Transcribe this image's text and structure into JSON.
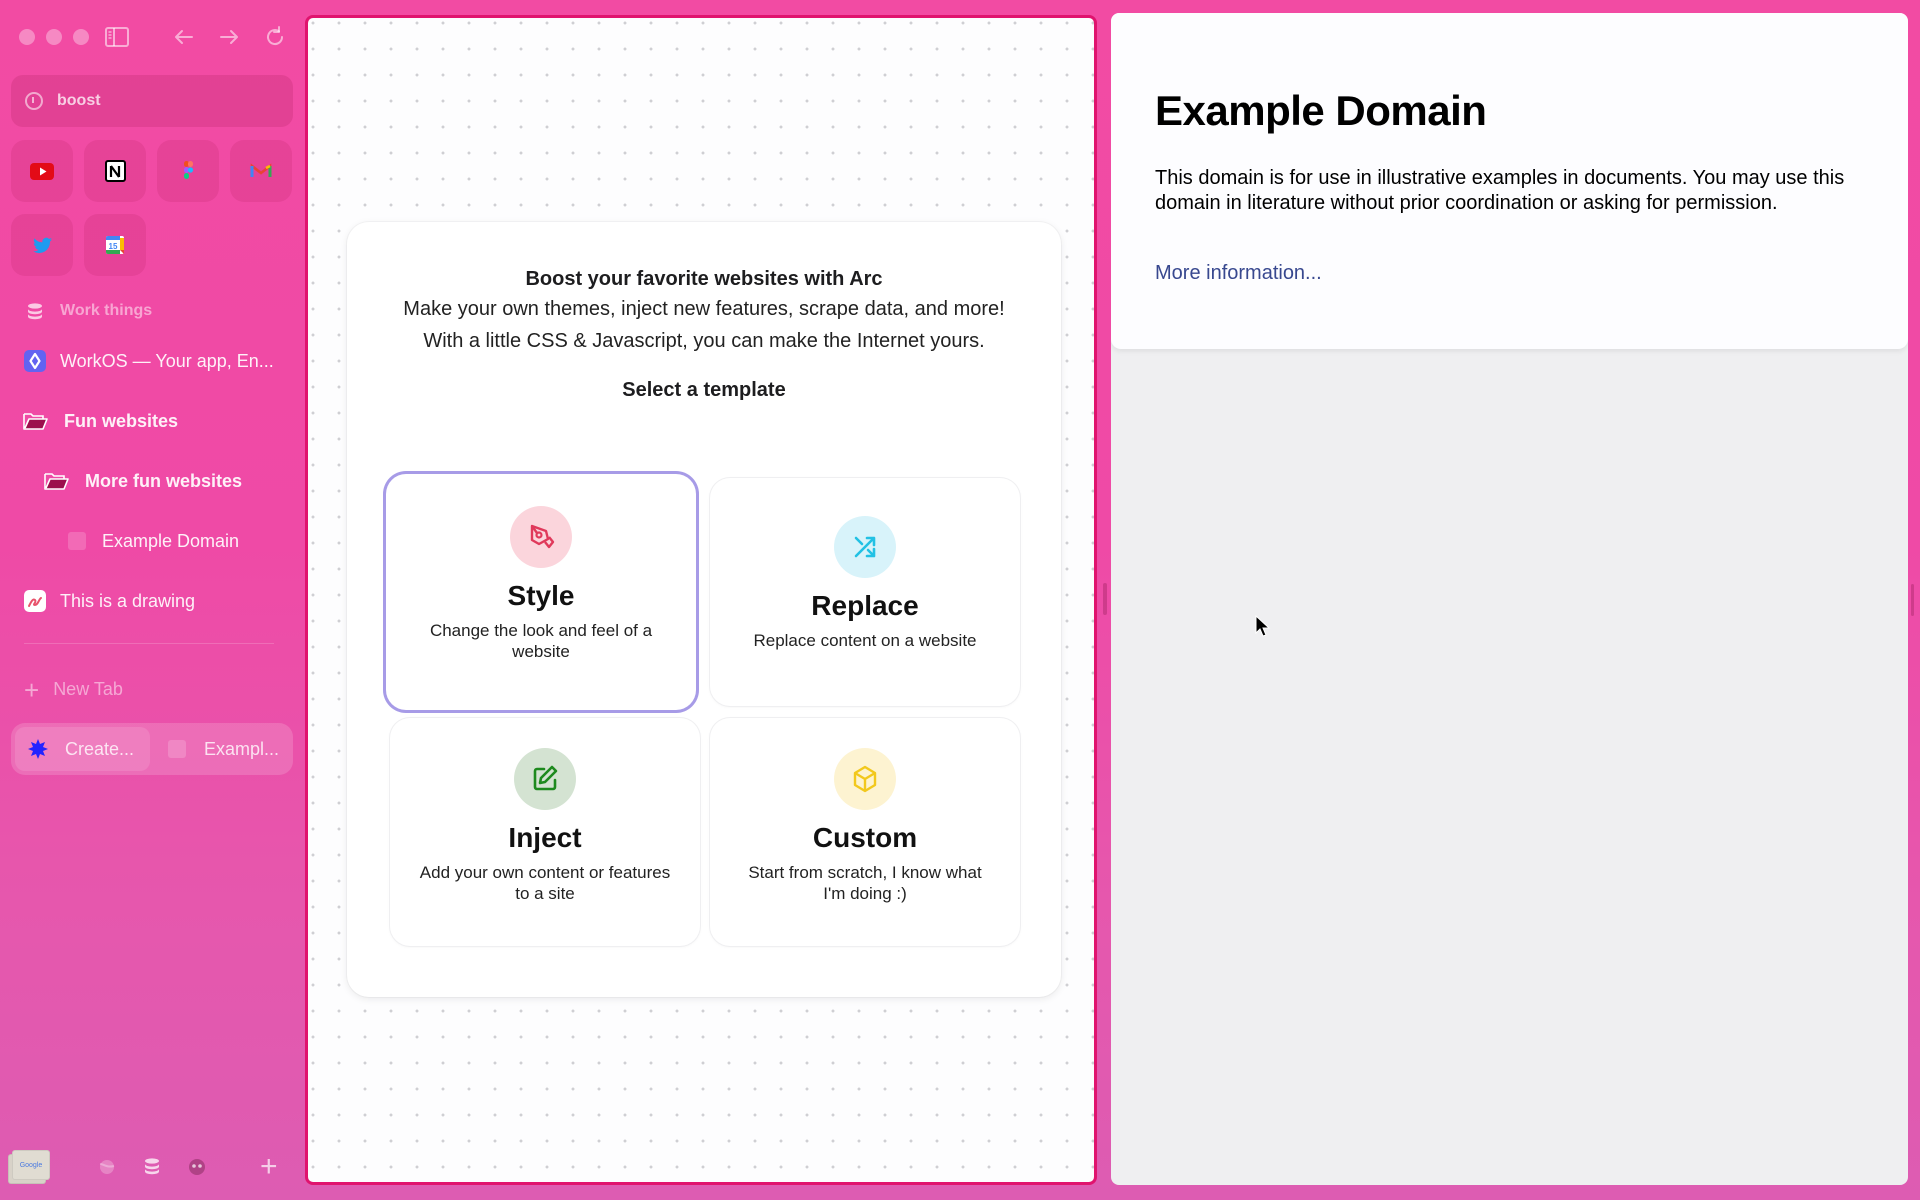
{
  "browser": {
    "address_bar": {
      "text": "boost"
    },
    "favorites": [
      {
        "name": "YouTube",
        "icon": "youtube-icon"
      },
      {
        "name": "Notion",
        "icon": "notion-icon"
      },
      {
        "name": "Figma",
        "icon": "figma-icon"
      },
      {
        "name": "Gmail",
        "icon": "gmail-icon"
      },
      {
        "name": "Twitter",
        "icon": "twitter-icon"
      },
      {
        "name": "Google Calendar",
        "icon": "calendar-icon",
        "badge": "15"
      }
    ],
    "space_label": "Work things",
    "tabs": [
      {
        "label": "WorkOS — Your app, En...",
        "icon": "workos-icon"
      },
      {
        "label": "Fun websites",
        "icon": "folder-icon",
        "type": "folder"
      },
      {
        "label": "More fun websites",
        "icon": "folder-icon",
        "type": "folder"
      },
      {
        "label": "Example Domain",
        "icon": "blank-page-icon"
      },
      {
        "label": "This is a drawing",
        "icon": "drawing-icon"
      }
    ],
    "new_tab_label": "New Tab",
    "split_tabs": [
      {
        "label": "Create...",
        "icon": "boost-star-icon",
        "active": true
      },
      {
        "label": "Exampl...",
        "icon": "blank-page-icon",
        "active": false
      }
    ],
    "library_thumb_text": "Google",
    "accent_color": "#e0136e",
    "sidebar_color": "#f24ba3"
  },
  "boost": {
    "title": "Boost your favorite websites with Arc",
    "description": "Make your own themes, inject new features, scrape data, and more! With a little CSS & Javascript, you can make the Internet yours.",
    "select_label": "Select a template",
    "templates": [
      {
        "name": "Style",
        "description": "Change the look and feel of a website",
        "icon": "pen-nib-icon",
        "color": "#e0395b",
        "bg": "#fbd5dc",
        "selected": true
      },
      {
        "name": "Replace",
        "description": "Replace content on a website",
        "icon": "shuffle-icon",
        "color": "#22c1e4",
        "bg": "#d8f3fa",
        "selected": false
      },
      {
        "name": "Inject",
        "description": "Add your own content or features to a site",
        "icon": "edit-square-icon",
        "color": "#1e8a1e",
        "bg": "#d4e3d2",
        "selected": false
      },
      {
        "name": "Custom",
        "description": "Start from scratch, I know what I'm doing :)",
        "icon": "cube-icon",
        "color": "#f2c81d",
        "bg": "#fdf3d1",
        "selected": false
      }
    ]
  },
  "example": {
    "heading": "Example Domain",
    "body": "This domain is for use in illustrative examples in documents. You may use this domain in literature without prior coordination or asking for permission.",
    "link": "More information..."
  }
}
